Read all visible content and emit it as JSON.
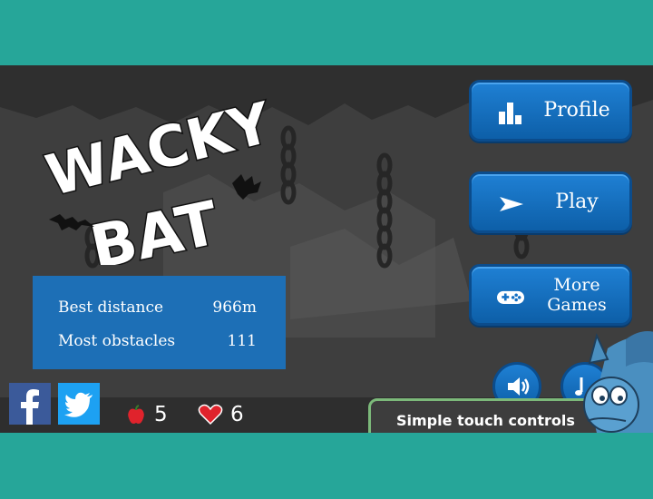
{
  "title": {
    "line1": "WACKY",
    "line2": "BAT"
  },
  "stats": {
    "best_distance": {
      "label": "Best distance",
      "value": "966m"
    },
    "most_obstacles": {
      "label": "Most obstacles",
      "value": "111"
    }
  },
  "menu": {
    "profile_label": "Profile",
    "play_label": "Play",
    "more_line1": "More",
    "more_line2": "Games"
  },
  "resources": {
    "apples": "5",
    "lives": "6"
  },
  "tip": "Simple touch controls",
  "icons": {
    "profile": "bar-chart-icon",
    "play": "play-icon",
    "more": "gamepad-icon",
    "sound": "speaker-icon",
    "music": "music-note-icon",
    "facebook": "facebook-icon",
    "twitter": "twitter-icon",
    "apple": "apple-icon",
    "heart": "heart-icon"
  },
  "colors": {
    "frame": "#26a699",
    "button_blue": "#1f80d4",
    "panel_blue": "#1d6fb6",
    "facebook": "#3b5a9a",
    "twitter": "#1da1f2",
    "apple": "#e0232c",
    "heart": "#e0232c",
    "tip_border": "#7cb97a"
  }
}
